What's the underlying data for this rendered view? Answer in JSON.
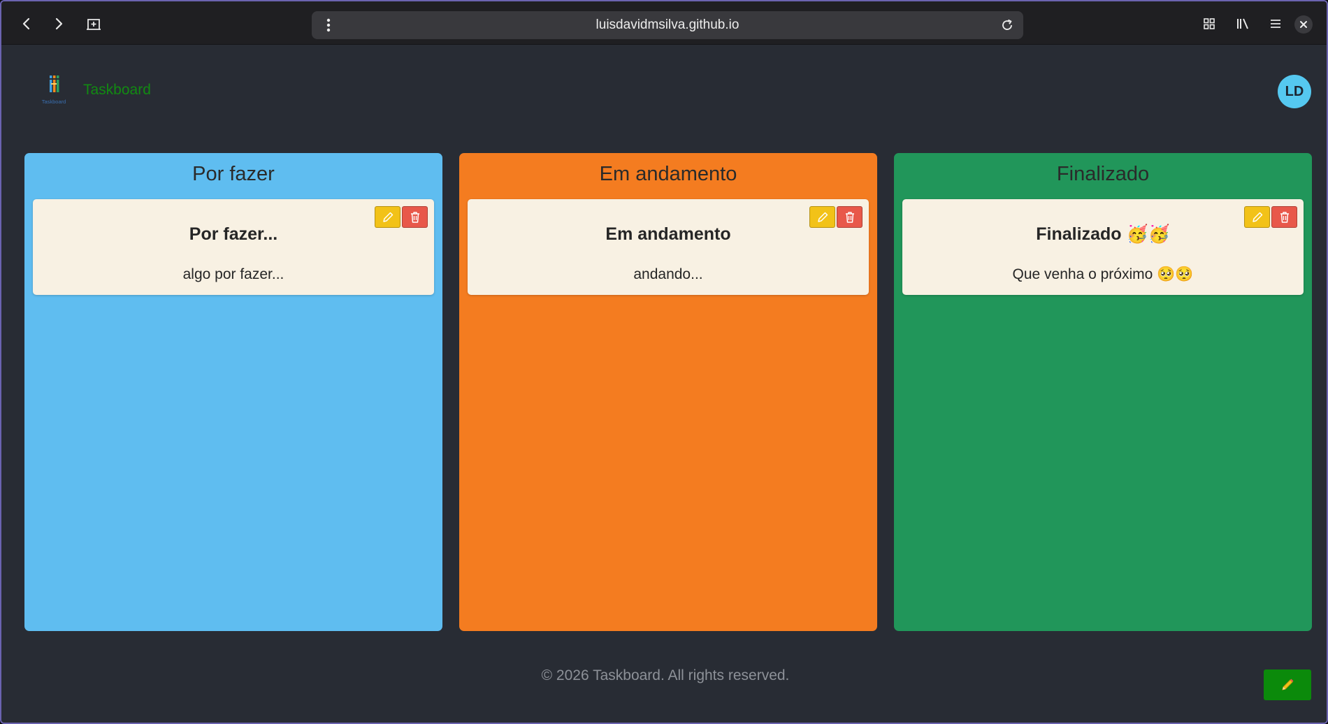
{
  "browser": {
    "url": "luisdavidmsilva.github.io"
  },
  "header": {
    "brand": "Taskboard",
    "logo_label": "Taskboard",
    "avatar_initials": "LD"
  },
  "columns": [
    {
      "title": "Por fazer",
      "color": "#5fbdf0",
      "cards": [
        {
          "title": "Por fazer...",
          "description": "algo por fazer..."
        }
      ]
    },
    {
      "title": "Em andamento",
      "color": "#f47c20",
      "cards": [
        {
          "title": "Em andamento",
          "description": "andando..."
        }
      ]
    },
    {
      "title": "Finalizado",
      "color": "#21965a",
      "cards": [
        {
          "title": "Finalizado 🥳🥳",
          "description": "Que venha o próximo 🥺🥺"
        }
      ]
    }
  ],
  "footer": {
    "copyright": "© 2026 Taskboard. All rights reserved."
  },
  "icons": {
    "back": "arrow-left-icon",
    "forward": "arrow-right-icon",
    "new_tab": "new-tab-icon",
    "menu": "kebab-menu-icon",
    "reload": "reload-icon",
    "extensions": "grid-icon",
    "library": "library-icon",
    "hamburger": "hamburger-menu-icon",
    "close": "close-icon",
    "edit": "pencil-icon",
    "delete": "trash-icon"
  },
  "colors": {
    "edit_button": "#f2c218",
    "delete_button": "#e8584a",
    "brand_text": "#128a12",
    "fab": "#0b8a0b",
    "avatar": "#55c8f0"
  }
}
